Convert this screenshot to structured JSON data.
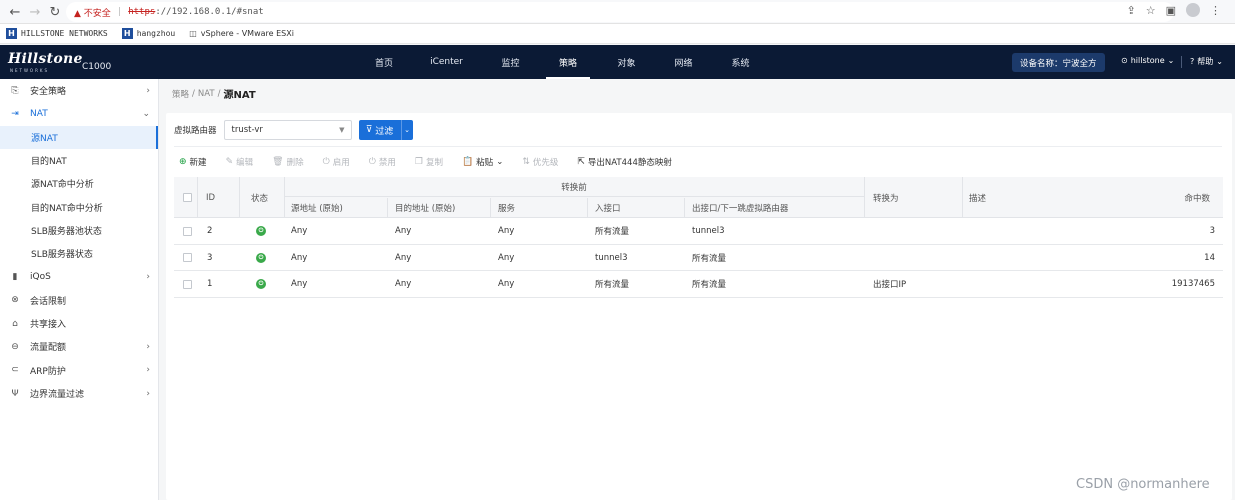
{
  "browser": {
    "security_warning": "▲ 不安全",
    "url_scheme": "https",
    "url_rest": "://192.168.0.1/#snat"
  },
  "bookmarks": [
    {
      "label": "HILLSTONE NETWORKS"
    },
    {
      "label": "hangzhou"
    },
    {
      "label": "vSphere - VMware ESXi"
    }
  ],
  "header": {
    "logo": "Hillstone",
    "logo_sub": "NETWORKS",
    "model": "C1000",
    "nav": [
      "首页",
      "iCenter",
      "监控",
      "策略",
      "对象",
      "网络",
      "系统"
    ],
    "active_nav": "策略",
    "device_name": "设备名称：宁波全方",
    "user": "hillstone",
    "help": "帮助"
  },
  "sidebar": {
    "items": [
      {
        "label": "安全策略",
        "icon": "policy-icon"
      },
      {
        "label": "NAT",
        "icon": "nat-icon"
      },
      {
        "label": "源NAT",
        "sub": true,
        "active": true
      },
      {
        "label": "目的NAT",
        "sub": true
      },
      {
        "label": "源NAT命中分析",
        "sub": true
      },
      {
        "label": "目的NAT命中分析",
        "sub": true
      },
      {
        "label": "SLB服务器池状态",
        "sub": true
      },
      {
        "label": "SLB服务器状态",
        "sub": true
      },
      {
        "label": "iQoS",
        "icon": "qos-icon"
      },
      {
        "label": "会话限制",
        "icon": "session-limit-icon"
      },
      {
        "label": "共享接入",
        "icon": "shared-access-icon"
      },
      {
        "label": "流量配额",
        "icon": "traffic-quota-icon"
      },
      {
        "label": "ARP防护",
        "icon": "arp-icon"
      },
      {
        "label": "边界流量过滤",
        "icon": "border-filter-icon"
      }
    ]
  },
  "breadcrumb": {
    "path1": "策略",
    "path2": "NAT",
    "current": "源NAT"
  },
  "filter": {
    "label": "虚拟路由器",
    "vr_value": "trust-vr",
    "button": "过滤"
  },
  "toolbar": {
    "new": "新建",
    "edit": "编辑",
    "delete": "删除",
    "enable": "启用",
    "disable": "禁用",
    "copy": "复制",
    "paste": "粘贴",
    "priority": "优先级",
    "export": "导出NAT444静态映射"
  },
  "table": {
    "headers": {
      "id": "ID",
      "status": "状态",
      "group": "转换前",
      "src": "源地址 (原始)",
      "dst": "目的地址 (原始)",
      "service": "服务",
      "ingress": "入接口",
      "egress": "出接口/下一跳虚拟路由器",
      "trans": "转换为",
      "desc": "描述",
      "hits": "命中数"
    },
    "rows": [
      {
        "id": "2",
        "src": "Any",
        "dst": "Any",
        "service": "Any",
        "ingress": "所有流量",
        "egress": "tunnel3",
        "trans": "",
        "desc": "",
        "hits": "3"
      },
      {
        "id": "3",
        "src": "Any",
        "dst": "Any",
        "service": "Any",
        "ingress": "tunnel3",
        "egress": "所有流量",
        "trans": "",
        "desc": "",
        "hits": "14"
      },
      {
        "id": "1",
        "src": "Any",
        "dst": "Any",
        "service": "Any",
        "ingress": "所有流量",
        "egress": "所有流量",
        "trans": "出接口IP",
        "desc": "",
        "hits": "19137465"
      }
    ]
  },
  "watermark": "CSDN @normanhere"
}
